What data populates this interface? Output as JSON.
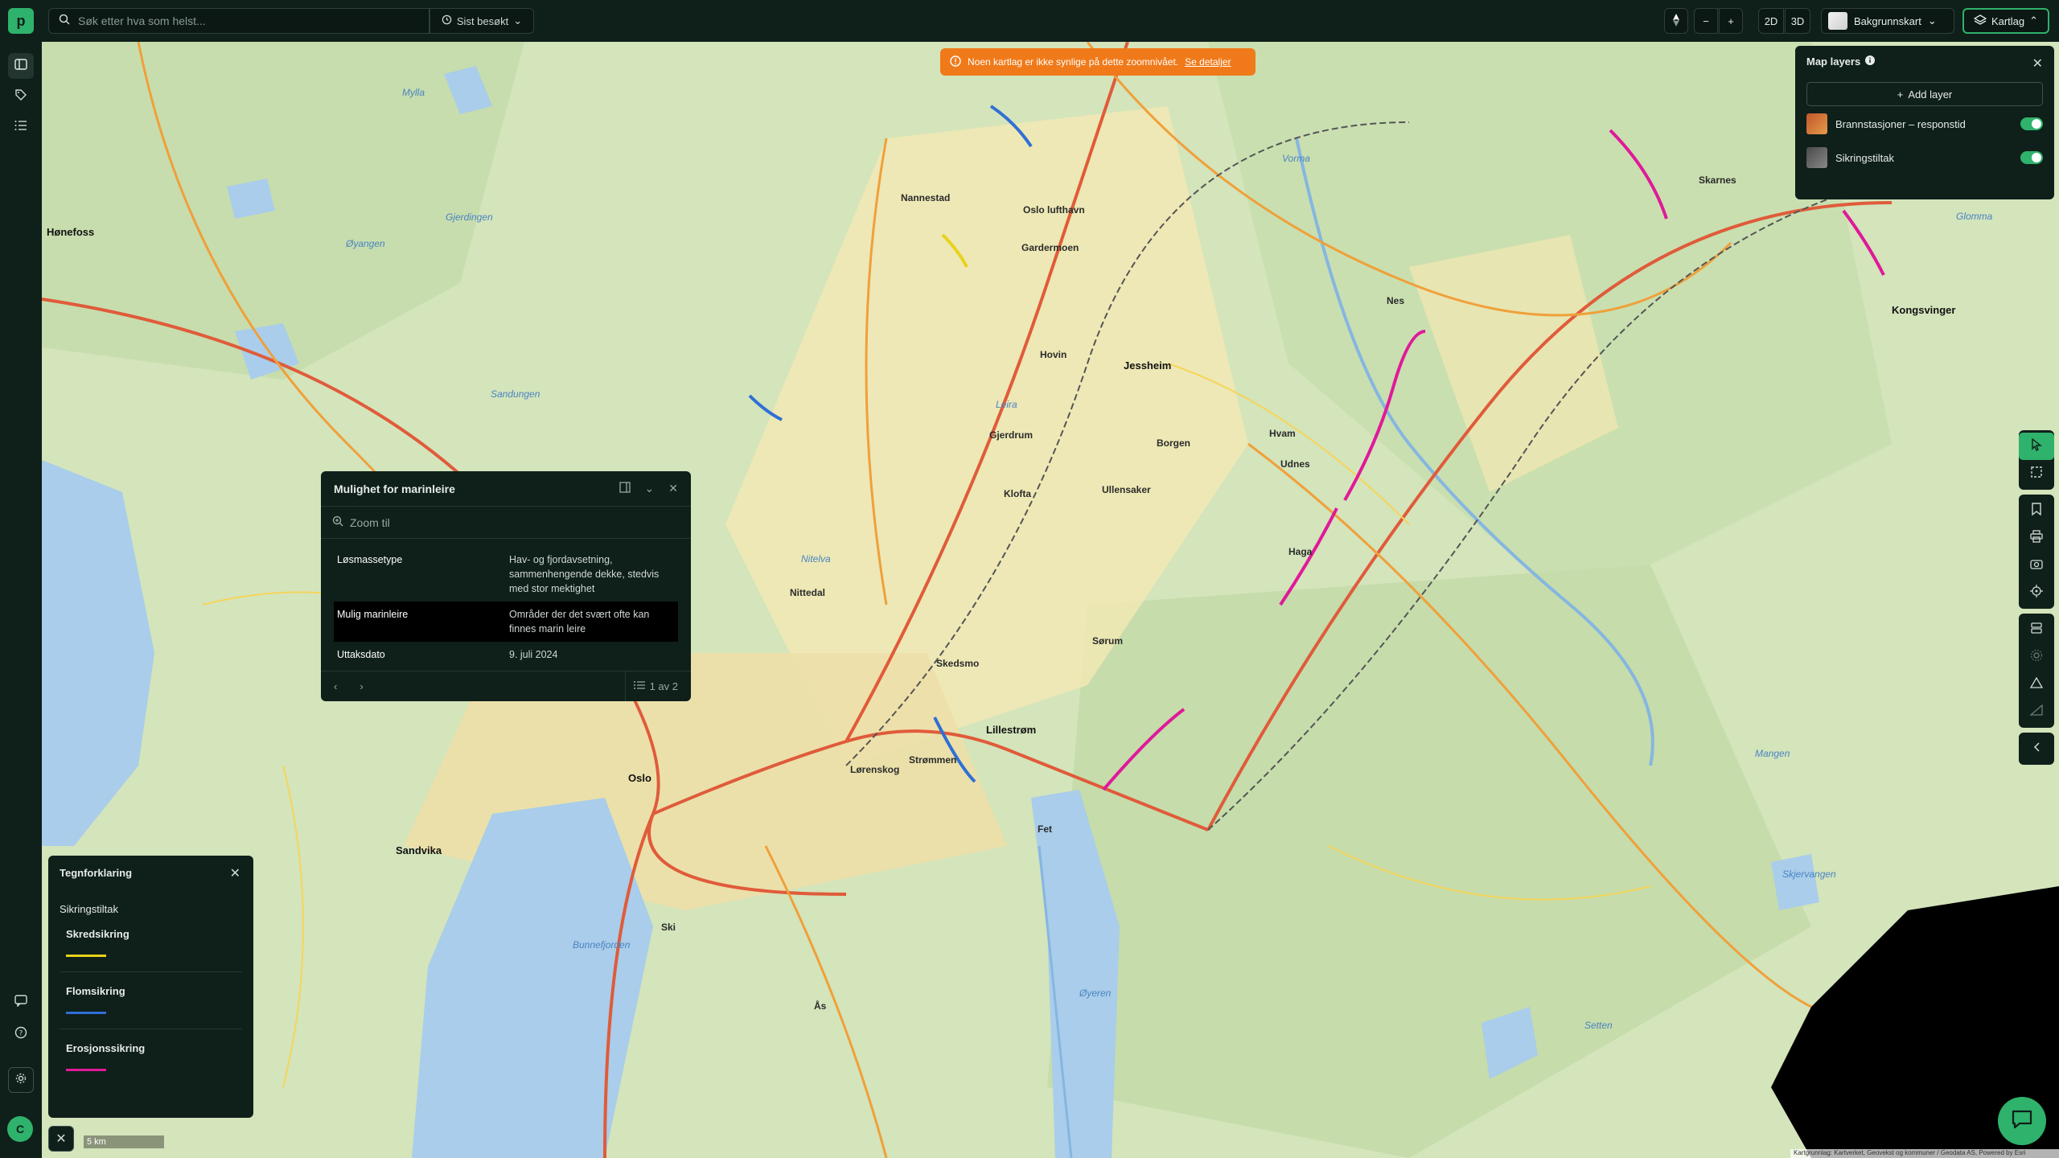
{
  "search": {
    "placeholder": "Søk etter hva som helst...",
    "recent_label": "Sist besøkt"
  },
  "toolbar": {
    "zoom_out": "−",
    "zoom_in": "+",
    "mode_2d": "2D",
    "mode_3d": "3D",
    "basemap_label": "Bakgrunnskart",
    "layers_label": "Kartlag"
  },
  "toast": {
    "message": "Noen kartlag er ikke synlige på dette zoomnivået.",
    "link": "Se detaljer"
  },
  "layers_panel": {
    "title": "Map layers",
    "add_label": "Add layer",
    "layers": [
      {
        "name": "Brannstasjoner – responstid",
        "enabled": true
      },
      {
        "name": "Sikringstiltak",
        "enabled": true
      }
    ]
  },
  "popup": {
    "title": "Mulighet for marinleire",
    "zoom_placeholder": "Zoom til",
    "rows": [
      {
        "key": "Løsmassetype",
        "value": "Hav- og fjordavsetning, sammenhengende dekke, stedvis med stor mektighet"
      },
      {
        "key": "Mulig marinleire",
        "value": "Områder der det svært ofte kan finnes marin leire"
      },
      {
        "key": "Uttaksdato",
        "value": "9. juli 2024"
      }
    ],
    "pager": "1 av 2"
  },
  "legend": {
    "title": "Tegnforklaring",
    "section": "Sikringstiltak",
    "items": [
      {
        "label": "Skredsikring",
        "color": "#e8d21a"
      },
      {
        "label": "Flomsikring",
        "color": "#2f6fd6"
      },
      {
        "label": "Erosjonssikring",
        "color": "#e0199a"
      }
    ]
  },
  "scale_label": "5 km",
  "attribution": "Kartgrunnlag: Kartverket, Geovekst og kommuner / Geodata AS, Powered by Esri",
  "avatar_initial": "C",
  "logo_letter": "p",
  "map_labels": {
    "places": [
      "Oslo",
      "Lillestrøm",
      "Jessheim",
      "Gardermoen",
      "Oslo lufthavn",
      "Sandvika",
      "Kongsvinger",
      "Hønefoss",
      "Nannestad",
      "Nittedal",
      "Skedsmo",
      "Lørenskog",
      "Strømmen",
      "Fet",
      "Sørum",
      "Ullensaker",
      "Hvam",
      "Haga",
      "Nes",
      "Udnes",
      "Klofta",
      "Hovin",
      "Gjerdrum",
      "Borgen",
      "Skarnes",
      "Ski",
      "Ås",
      "Øyeren",
      "Mangen",
      "Setten"
    ],
    "water": [
      "Mylla",
      "Gjerdingen",
      "Sandungen",
      "Øyangen",
      "Glomma",
      "Vorma",
      "Mangen",
      "Setten",
      "Skjervangen",
      "Øyeren",
      "Bunnefjorden",
      "Leira",
      "Nitelva"
    ]
  }
}
